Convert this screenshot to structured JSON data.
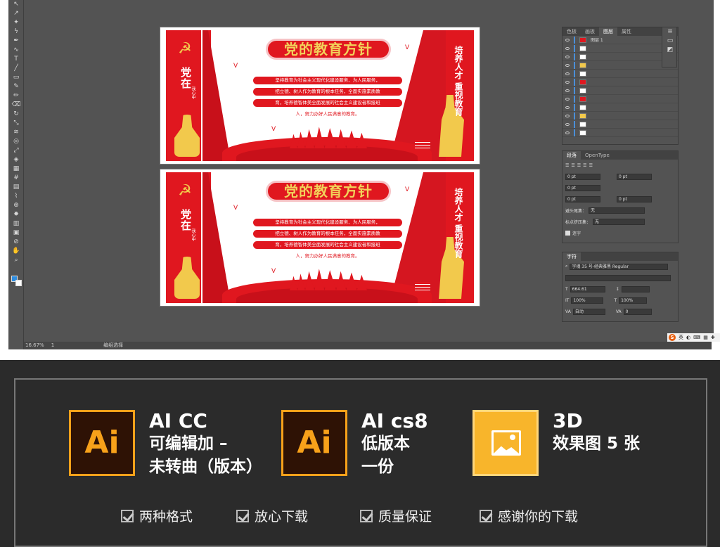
{
  "editor": {
    "zoom": "16.67%",
    "artboard_num": "1",
    "status_label": "编组选择",
    "tool_icons": [
      "selection-tool-icon",
      "direct-select-icon",
      "magic-wand-icon",
      "lasso-icon",
      "pen-icon",
      "curvature-icon",
      "type-icon",
      "line-icon",
      "rectangle-icon",
      "paintbrush-icon",
      "pencil-icon",
      "eraser-icon",
      "rotate-icon",
      "scale-icon",
      "width-icon",
      "warp-icon",
      "free-transform-icon",
      "shape-builder-icon",
      "perspective-icon",
      "mesh-icon",
      "gradient-icon",
      "eyedropper-icon",
      "blend-icon",
      "symbol-sprayer-icon",
      "graph-icon",
      "artboard-icon",
      "slice-icon",
      "hand-icon",
      "zoom-icon"
    ]
  },
  "artboard": {
    "title": "党的教育方针",
    "left_vertical": "党在",
    "left_vertical_small": "我心中",
    "right_vertical_1": "重视教育",
    "right_vertical_2": "培养人才",
    "lines": [
      "坚持教育为社会主义现代化建设服务、为人民服务，",
      "把立德、树人作为教育的根本任务，全面实施素质教",
      "育，培养德智体美全面发展的社会主义建设者和接班",
      "人，努力办好人民满意的教育。"
    ]
  },
  "layers_panel": {
    "tabs": [
      "色板",
      "画板",
      "图层",
      "属性"
    ],
    "active_tab": "图层",
    "top_layer": "图层 1",
    "row_count": 12
  },
  "paragraph_panel": {
    "tabs": [
      "段落",
      "OpenType"
    ],
    "values": [
      "0 pt",
      "0 pt",
      "0 pt",
      "0 pt",
      "0 pt"
    ],
    "kinsoku_label": "避头尾集：",
    "kinsoku_value": "无",
    "mojikumi_label": "标点挤压集：",
    "mojikumi_value": "无",
    "hyphen_label": "连字"
  },
  "character_panel": {
    "tab": "字符",
    "font": "字魂 35 号-经典雅黑 Regular",
    "size": "664.61",
    "scale_h": "100%",
    "scale_v": "100%",
    "leading": "自动",
    "tracking": "0"
  },
  "taskbar": {
    "ime_label": "英"
  },
  "promo": {
    "badge1": {
      "icon_text": "Ai",
      "line1": "AI CC",
      "line2": "可编辑加 –",
      "line3": "未转曲（版本）"
    },
    "badge2": {
      "icon_text": "Ai",
      "line1": "AI cs8",
      "line2": "低版本",
      "line3": "一份"
    },
    "badge3": {
      "line1": "3D",
      "line2": "效果图 5 张"
    },
    "checks": [
      "两种格式",
      "放心下载",
      "质量保证",
      "感谢你的下载"
    ]
  },
  "colors": {
    "party_red": "#e0171f",
    "gold": "#f2c94c",
    "ai_orange": "#f7a11a",
    "ai_dark": "#2e1205",
    "image_badge": "#f8b52b"
  }
}
